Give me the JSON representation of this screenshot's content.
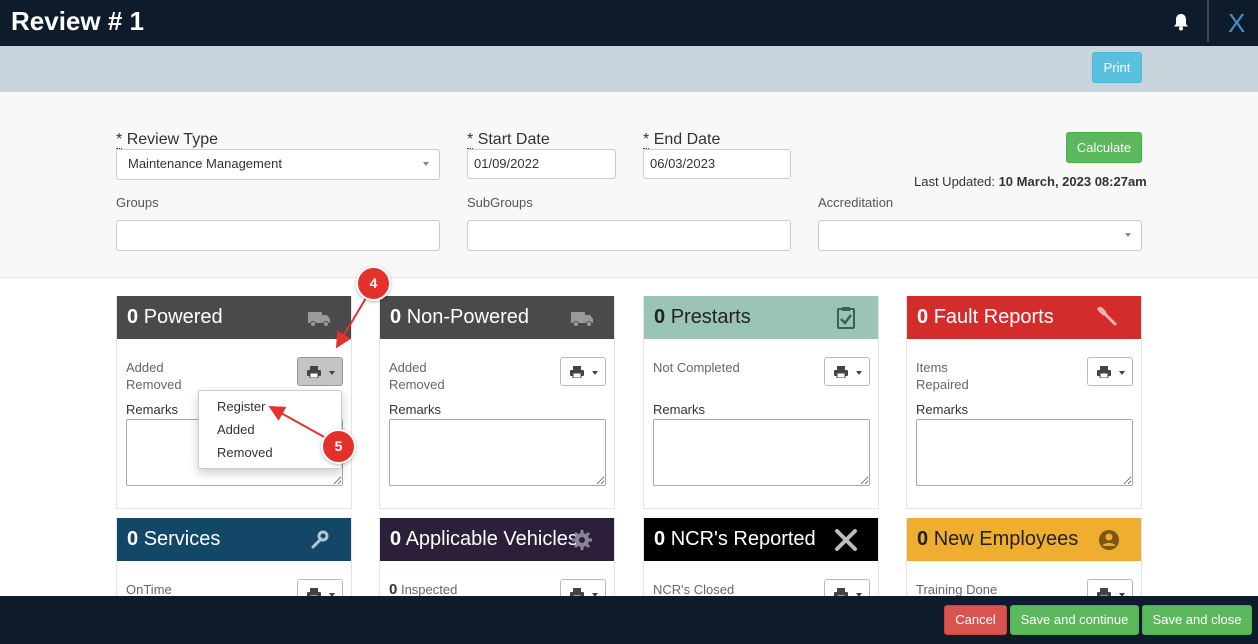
{
  "header": {
    "title": "Review # 1",
    "close_label": "X"
  },
  "toolbar": {
    "print_label": "Print"
  },
  "filters": {
    "review_type": {
      "label": "Review Type",
      "value": "Maintenance Management"
    },
    "start_date": {
      "label": "Start Date",
      "value": "01/09/2022"
    },
    "end_date": {
      "label": "End Date",
      "value": "06/03/2023"
    },
    "required_mark": "*",
    "calculate_label": "Calculate",
    "last_updated_label": "Last Updated:",
    "last_updated_value": "10 March, 2023 08:27am",
    "groups_label": "Groups",
    "subgroups_label": "SubGroups",
    "accreditation_label": "Accreditation"
  },
  "cards": [
    {
      "count": "0",
      "title": "Powered",
      "color": "#4a4a4a",
      "info": [
        "Added",
        "Removed"
      ],
      "remarks": "Remarks"
    },
    {
      "count": "0",
      "title": "Non-Powered",
      "color": "#4a4a4a",
      "info": [
        "Added",
        "Removed"
      ],
      "remarks": "Remarks"
    },
    {
      "count": "0",
      "title": "Prestarts",
      "color": "#9bc4b9",
      "info": [
        "Not Completed"
      ],
      "remarks": "Remarks"
    },
    {
      "count": "0",
      "title": "Fault Reports",
      "color": "#d42b2b",
      "info": [
        "Items",
        "Repaired"
      ],
      "remarks": "Remarks"
    },
    {
      "count": "0",
      "title": "Services",
      "color": "#124767",
      "info": [
        "OnTime"
      ]
    },
    {
      "count": "0",
      "title": "Applicable Vehicles",
      "color": "#2c1f3a",
      "info_count": "0",
      "info": [
        "Inspected"
      ]
    },
    {
      "count": "0",
      "title": "NCR's Reported",
      "color": "#000000",
      "info": [
        "NCR's Closed"
      ]
    },
    {
      "count": "0",
      "title": "New Employees",
      "color": "#efae2f",
      "info": [
        "Training Done"
      ]
    }
  ],
  "print_menu": [
    "Register",
    "Added",
    "Removed"
  ],
  "annotations": [
    "4",
    "5"
  ],
  "footer": {
    "cancel_label": "Cancel",
    "save_continue_label": "Save and continue",
    "save_close_label": "Save and close"
  }
}
